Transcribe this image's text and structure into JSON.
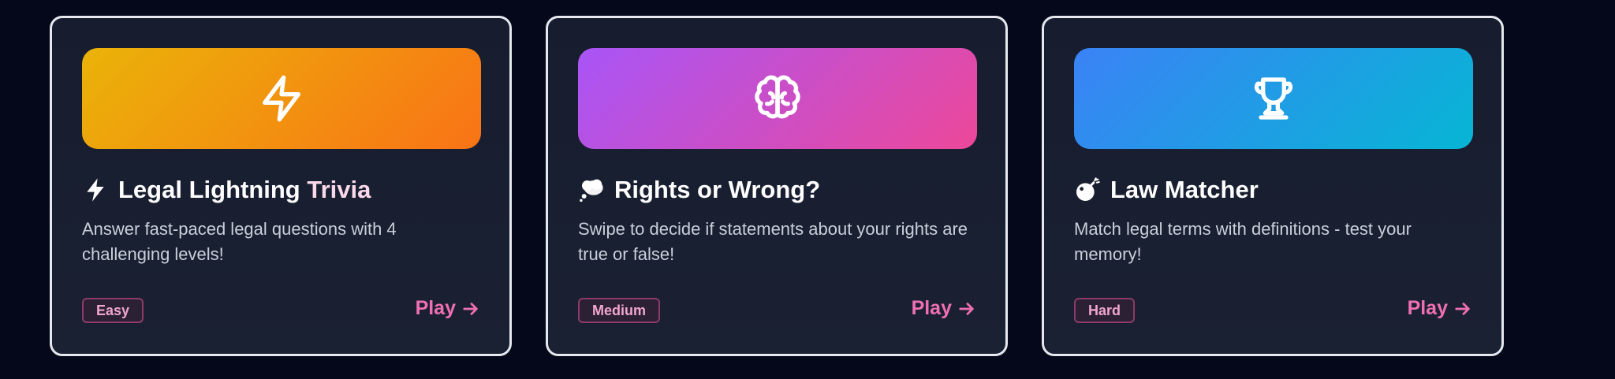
{
  "colors": {
    "background": "#05081a",
    "card_border": "#e6e8ee",
    "accent_pink": "#f06fb4",
    "badge_text": "#f0a6cc"
  },
  "games": [
    {
      "banner_icon": "lightning-icon",
      "banner_gradient": [
        "#eab308",
        "#f97316"
      ],
      "title_emoji": "lightning-emoji-icon",
      "title": "Legal Lightning",
      "title_tail": " Trivia",
      "description": "Answer fast-paced legal questions with 4 challenging levels!",
      "difficulty": "Easy",
      "play_label": "Play"
    },
    {
      "banner_icon": "brain-icon",
      "banner_gradient": [
        "#a855f7",
        "#ec4899"
      ],
      "title_emoji": "thought-bubble-emoji-icon",
      "title": "Rights or Wrong?",
      "title_tail": "",
      "description": "Swipe to decide if statements about your rights are true or false!",
      "difficulty": "Medium",
      "play_label": "Play"
    },
    {
      "banner_icon": "trophy-icon",
      "banner_gradient": [
        "#3b82f6",
        "#06b6d4"
      ],
      "title_emoji": "bomb-emoji-icon",
      "title": "Law Matcher",
      "title_tail": "",
      "description": "Match legal terms with definitions - test your memory!",
      "difficulty": "Hard",
      "play_label": "Play"
    }
  ]
}
